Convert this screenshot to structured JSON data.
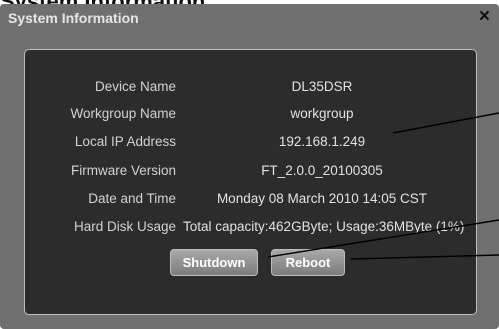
{
  "doc_heading": "System Information",
  "dialog": {
    "title": "System Information",
    "close_glyph": "×"
  },
  "info_rows": [
    {
      "label": "Device Name",
      "value": "DL35DSR"
    },
    {
      "label": "Workgroup Name",
      "value": "workgroup"
    },
    {
      "label": "Local IP Address",
      "value": "192.168.1.249"
    },
    {
      "label": "Firmware Version",
      "value": "FT_2.0.0_20100305"
    },
    {
      "label": "Date and Time",
      "value": "Monday 08 March 2010 14:05 CST"
    },
    {
      "label": "Hard Disk Usage",
      "value": "Total capacity:462GByte; Usage:36MByte (1%)"
    }
  ],
  "buttons": {
    "shutdown": "Shutdown",
    "reboot": "Reboot"
  },
  "colors": {
    "dialog_bg": "#707070",
    "panel_bg": "#2c2c2c",
    "text": "#e2e2e2",
    "button": "#8f8f8f"
  }
}
